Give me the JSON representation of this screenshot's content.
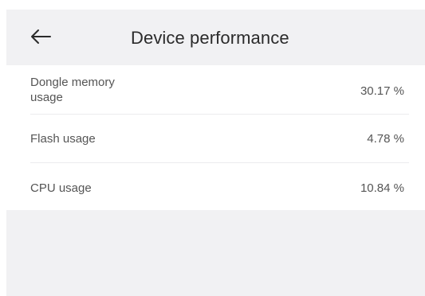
{
  "header": {
    "title": "Device performance",
    "back_icon": "arrow-left-icon"
  },
  "metrics": [
    {
      "label": "Dongle memory usage",
      "value": "30.17 %"
    },
    {
      "label": "Flash usage",
      "value": "4.78 %"
    },
    {
      "label": "CPU usage",
      "value": "10.84 %"
    }
  ],
  "colors": {
    "header_background": "#f1f1f3",
    "text": "#555555",
    "title_text": "#2b2b2b"
  }
}
